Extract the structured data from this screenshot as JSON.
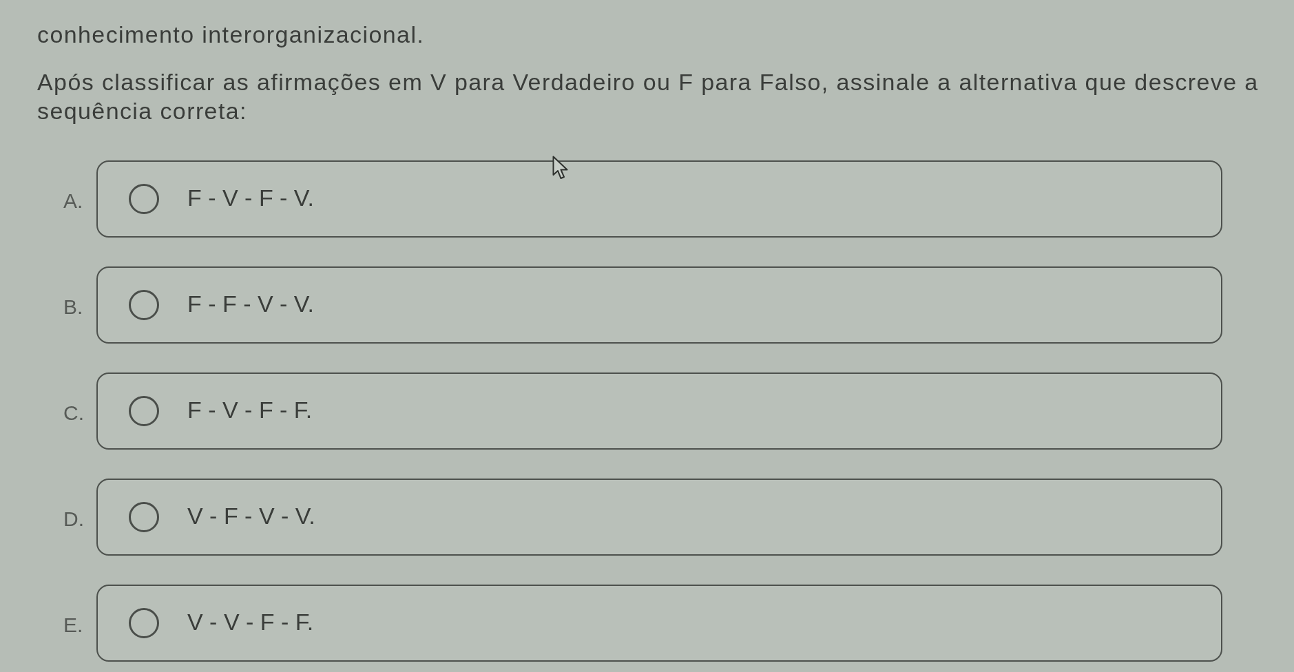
{
  "question": {
    "text_fragment": "conhecimento interorganizacional.",
    "instruction": "Após classificar as afirmações em V para Verdadeiro ou F para Falso, assinale a alternativa que descreve a sequência correta:"
  },
  "options": [
    {
      "letter": "A.",
      "text": "F - V - F - V.",
      "selected": false
    },
    {
      "letter": "B.",
      "text": "F - F - V - V.",
      "selected": false
    },
    {
      "letter": "C.",
      "text": "F - V - F - F.",
      "selected": false
    },
    {
      "letter": "D.",
      "text": "V - F - V - V.",
      "selected": false
    },
    {
      "letter": "E.",
      "text": "V - V - F - F.",
      "selected": false
    }
  ]
}
